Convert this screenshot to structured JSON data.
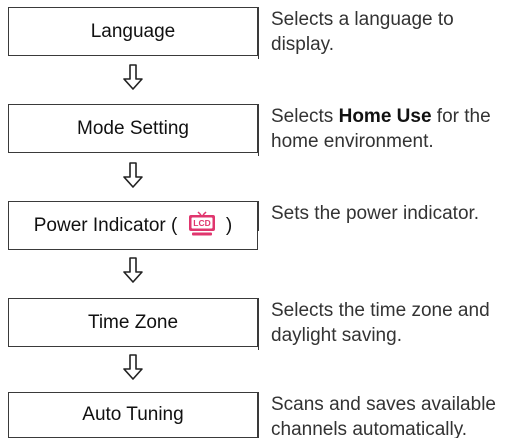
{
  "steps": [
    {
      "label": "Language",
      "description": "Selects a language to display."
    },
    {
      "label": "Mode Setting",
      "description_prefix": "Selects ",
      "description_bold": "Home Use",
      "description_suffix": " for the home environment."
    },
    {
      "label_prefix": "Power Indicator (",
      "label_icon": "lcd-icon",
      "label_icon_text": "LCD",
      "label_suffix": ")",
      "description": "Sets the power indicator."
    },
    {
      "label": "Time Zone",
      "description": "Selects the time zone and daylight saving."
    },
    {
      "label": "Auto Tuning",
      "description": "Scans and saves available channels automatically."
    }
  ],
  "arrow_icon": "down-arrow-icon",
  "colors": {
    "border": "#3a3a3a",
    "icon": "#e0366e"
  }
}
